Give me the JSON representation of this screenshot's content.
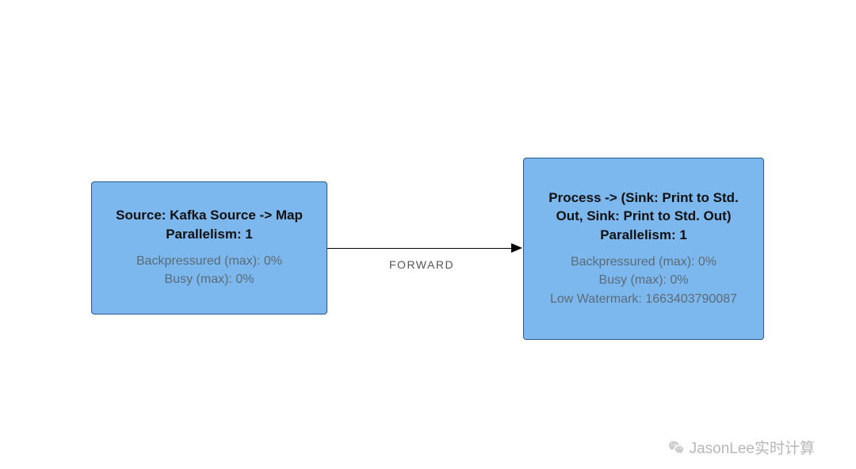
{
  "nodes": {
    "source": {
      "title": "Source: Kafka Source -> Map",
      "parallelism_label": "Parallelism: 1",
      "backpressure": "Backpressured (max): 0%",
      "busy": "Busy (max): 0%"
    },
    "process": {
      "title": "Process -> (Sink: Print to Std. Out, Sink: Print to Std. Out)",
      "parallelism_label": "Parallelism: 1",
      "backpressure": "Backpressured (max): 0%",
      "busy": "Busy (max): 0%",
      "low_watermark": "Low Watermark: 1663403790087"
    }
  },
  "edge": {
    "label": "FORWARD"
  },
  "watermark_text": "JasonLee实时计算"
}
